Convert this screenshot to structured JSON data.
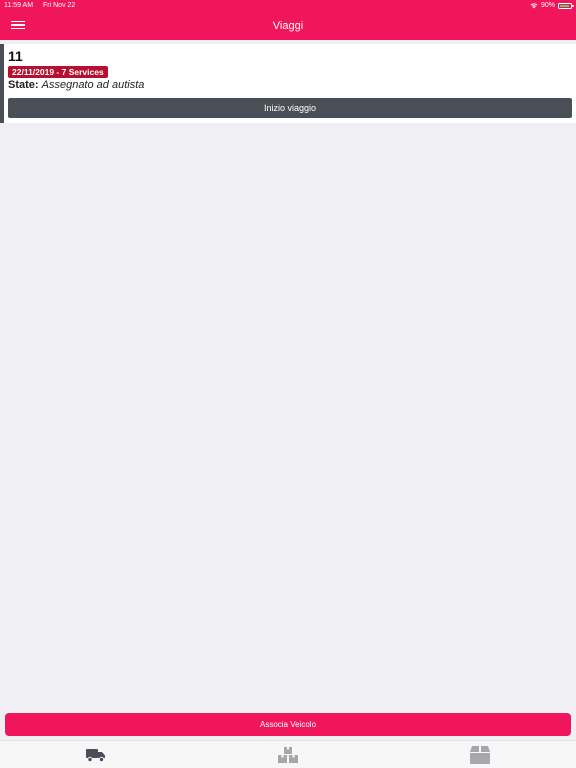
{
  "status_bar": {
    "time": "11:59 AM",
    "date": "Fri Nov 22",
    "battery": "90%",
    "battery_level": 0.9
  },
  "nav": {
    "title": "Viaggi",
    "menu_icon": "hamburger-icon"
  },
  "trip": {
    "number": "11",
    "badge": "22/11/2019 - 7 Services",
    "state_label": "State:",
    "state_value": "Assegnato ad autista",
    "start_button": "Inizio viaggio"
  },
  "footer": {
    "assoc_button": "Associa Veicolo"
  },
  "tabs": [
    {
      "icon": "truck-icon",
      "active": true
    },
    {
      "icon": "boxes-icon",
      "active": false
    },
    {
      "icon": "package-icon",
      "active": false
    }
  ],
  "colors": {
    "accent": "#f0155d",
    "badge": "#b5102f",
    "dark_button": "#4a4f57",
    "background": "#efeff4"
  }
}
